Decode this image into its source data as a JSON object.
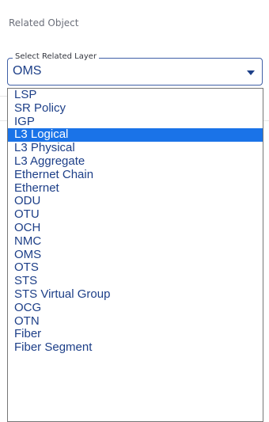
{
  "panel": {
    "title": "Related Object"
  },
  "layer_select": {
    "legend": "Select Related Layer",
    "value": "OMS",
    "highlighted_option": "L3 Logical",
    "options": [
      "LSP",
      "SR Policy",
      "IGP",
      "L3 Logical",
      "L3 Physical",
      "L3 Aggregate",
      "Ethernet Chain",
      "Ethernet",
      "ODU",
      "OTU",
      "OCH",
      "NMC",
      "OMS",
      "OTS",
      "STS",
      "STS Virtual Group",
      "OCG",
      "OTN",
      "Fiber",
      "Fiber Segment"
    ]
  }
}
